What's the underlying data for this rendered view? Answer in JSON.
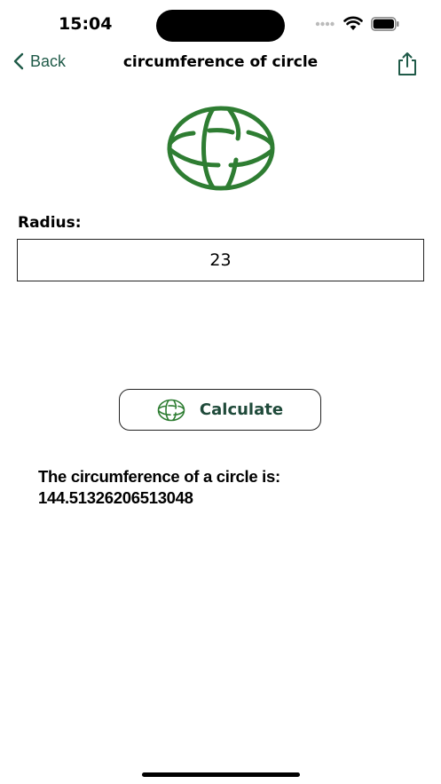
{
  "status_bar": {
    "time": "15:04",
    "icons": [
      "signal-dots-icon",
      "wifi-icon",
      "battery-icon"
    ]
  },
  "nav": {
    "back_label": "Back",
    "title": "circumference of circle",
    "share_icon": "share-icon"
  },
  "form": {
    "radius_label": "Radius:",
    "radius_value": "23"
  },
  "calculate_button": {
    "label": "Calculate",
    "icon": "globe-icon"
  },
  "result": {
    "label": "The circumference of a circle is:",
    "value": "144.51326206513048"
  },
  "colors": {
    "accent_green": "#2e7d32",
    "button_text": "#1f4a3a",
    "back_text": "#1f5a48"
  }
}
